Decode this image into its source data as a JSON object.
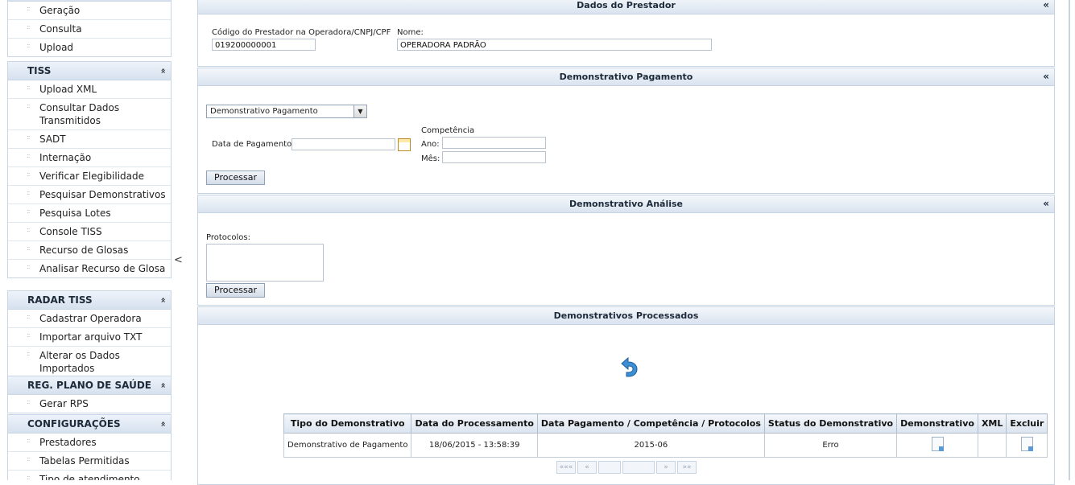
{
  "sidebar": {
    "block0": {
      "items": [
        "Geração",
        "Consulta",
        "Upload"
      ]
    },
    "tiss": {
      "title": "TISS",
      "collapse": "«",
      "items": [
        "Upload XML",
        "Consultar Dados Transmitidos",
        "SADT",
        "Internação",
        "Verificar Elegibilidade",
        "Pesquisar Demonstrativos",
        "Pesquisa Lotes",
        "Console TISS",
        "Recurso de Glosas",
        "Analisar Recurso de Glosa"
      ]
    },
    "radar": {
      "title": "RADAR TISS",
      "collapse": "«",
      "items": [
        "Cadastrar Operadora",
        "Importar arquivo TXT",
        "Alterar os Dados Importados"
      ]
    },
    "reg": {
      "title": "REG. PLANO DE SAÚDE",
      "collapse": "«",
      "items": [
        "Gerar RPS"
      ]
    },
    "config": {
      "title": "CONFIGURAÇÕES",
      "collapse": "«",
      "items": [
        "Prestadores",
        "Tabelas Permitidas",
        "Tipo de atendimento"
      ]
    },
    "toggle": "<"
  },
  "prestador": {
    "title": "Dados do Prestador",
    "collapse": "«",
    "codigo_label": "Código do Prestador na Operadora/CNPJ/CPF",
    "codigo_value": "019200000001",
    "nome_label": "Nome:",
    "nome_value": "OPERADORA PADRÃO"
  },
  "pagamento": {
    "title": "Demonstrativo Pagamento",
    "collapse": "«",
    "select_value": "Demonstrativo Pagamento",
    "data_label": "Data de Pagamento:",
    "data_value": "",
    "competencia_label": "Competência",
    "ano_label": "Ano:",
    "mes_label": "Mês:",
    "processar": "Processar"
  },
  "analise": {
    "title": "Demonstrativo Análise",
    "collapse": "«",
    "protocolos_label": "Protocolos:",
    "processar": "Processar"
  },
  "processados": {
    "title": "Demonstrativos Processados",
    "columns": [
      "Tipo do Demonstrativo",
      "Data do Processamento",
      "Data Pagamento / Competência / Protocolos",
      "Status do Demonstrativo",
      "Demonstrativo",
      "XML",
      "Excluir"
    ],
    "rows": [
      {
        "tipo": "Demonstrativo de Pagamento",
        "data": "18/06/2015 - 13:58:39",
        "competencia": "2015-06",
        "status": "Erro"
      }
    ],
    "pager": [
      "«««",
      "«",
      "",
      "",
      "»",
      "»»"
    ]
  }
}
